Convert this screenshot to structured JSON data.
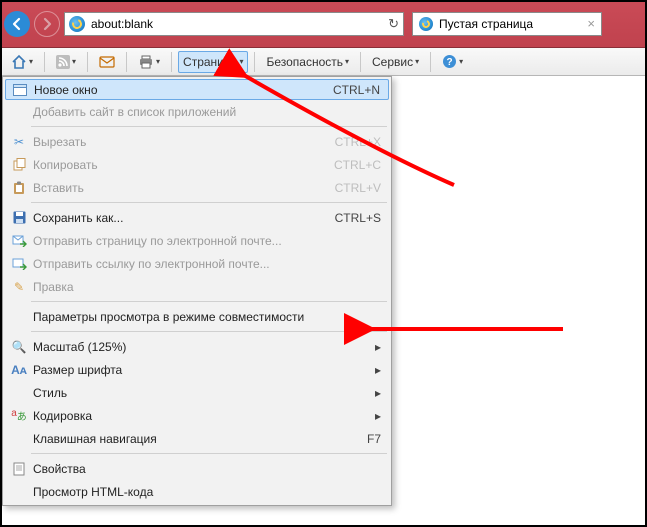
{
  "address": {
    "url": "about:blank"
  },
  "tab": {
    "title": "Пустая страница"
  },
  "commandbar": {
    "page": "Страница",
    "safety": "Безопасность",
    "tools": "Сервис"
  },
  "menu": {
    "new_window": {
      "label": "Новое окно",
      "shortcut": "CTRL+N"
    },
    "add_site": {
      "label": "Добавить сайт в список приложений"
    },
    "cut": {
      "label": "Вырезать",
      "shortcut": "CTRL+X"
    },
    "copy": {
      "label": "Копировать",
      "shortcut": "CTRL+C"
    },
    "paste": {
      "label": "Вставить",
      "shortcut": "CTRL+V"
    },
    "save_as": {
      "label": "Сохранить как...",
      "shortcut": "CTRL+S"
    },
    "send_page": {
      "label": "Отправить страницу по электронной почте..."
    },
    "send_link": {
      "label": "Отправить ссылку по электронной почте..."
    },
    "edit": {
      "label": "Правка"
    },
    "compat": {
      "label": "Параметры просмотра в режиме совместимости"
    },
    "zoom": {
      "label": "Масштаб (125%)"
    },
    "text_size": {
      "label": "Размер шрифта"
    },
    "style": {
      "label": "Стиль"
    },
    "encoding": {
      "label": "Кодировка"
    },
    "caret": {
      "label": "Клавишная навигация",
      "shortcut": "F7"
    },
    "props": {
      "label": "Свойства"
    },
    "source": {
      "label": "Просмотр HTML-кода"
    }
  }
}
